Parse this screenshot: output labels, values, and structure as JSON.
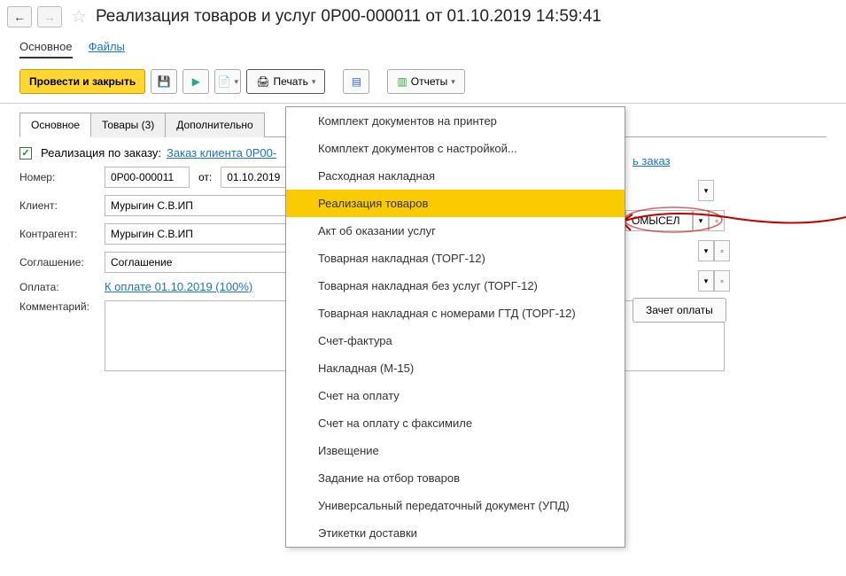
{
  "header": {
    "title": "Реализация товаров и услуг 0Р00-000011 от 01.10.2019 14:59:41",
    "tab_main": "Основное",
    "tab_files": "Файлы"
  },
  "toolbar": {
    "post_close": "Провести и закрыть",
    "print": "Печать",
    "reports": "Отчеты"
  },
  "inner_tabs": {
    "main": "Основное",
    "goods": "Товары (3)",
    "extra": "Дополнительно"
  },
  "form": {
    "realization_by_order": "Реализация по заказу: ",
    "order_link": "Заказ клиента 0Р00-",
    "number_lbl": "Номер:",
    "number_val": "0Р00-000011",
    "from_lbl": "от:",
    "date_val": "01.10.2019",
    "client_lbl": "Клиент:",
    "client_val": "Мурыгин С.В.ИП",
    "counterparty_lbl": "Контрагент:",
    "counterparty_val": "Мурыгин С.В.ИП",
    "agreement_lbl": "Соглашение:",
    "agreement_val": "Соглашение",
    "payment_lbl": "Оплата:",
    "payment_link": "К оплате 01.10.2019 (100%)",
    "comment_lbl": "Комментарий:",
    "right_order_link": "ь заказ",
    "right_val_peek": "ОМЫСЕЛ",
    "zachet_btn": "Зачет оплаты"
  },
  "dropdown": [
    "Комплект документов на принтер",
    "Комплект документов с настройкой...",
    "Расходная накладная",
    "Реализация товаров",
    "Акт об оказании услуг",
    "Товарная накладная (ТОРГ-12)",
    "Товарная накладная без услуг (ТОРГ-12)",
    "Товарная накладная с номерами ГТД (ТОРГ-12)",
    "Счет-фактура",
    "Накладная (М-15)",
    "Счет на оплату",
    "Счет на оплату с факсимиле",
    "Извещение",
    "Задание на отбор товаров",
    "Универсальный передаточный документ (УПД)",
    "Этикетки доставки"
  ],
  "dropdown_highlight_index": 3
}
